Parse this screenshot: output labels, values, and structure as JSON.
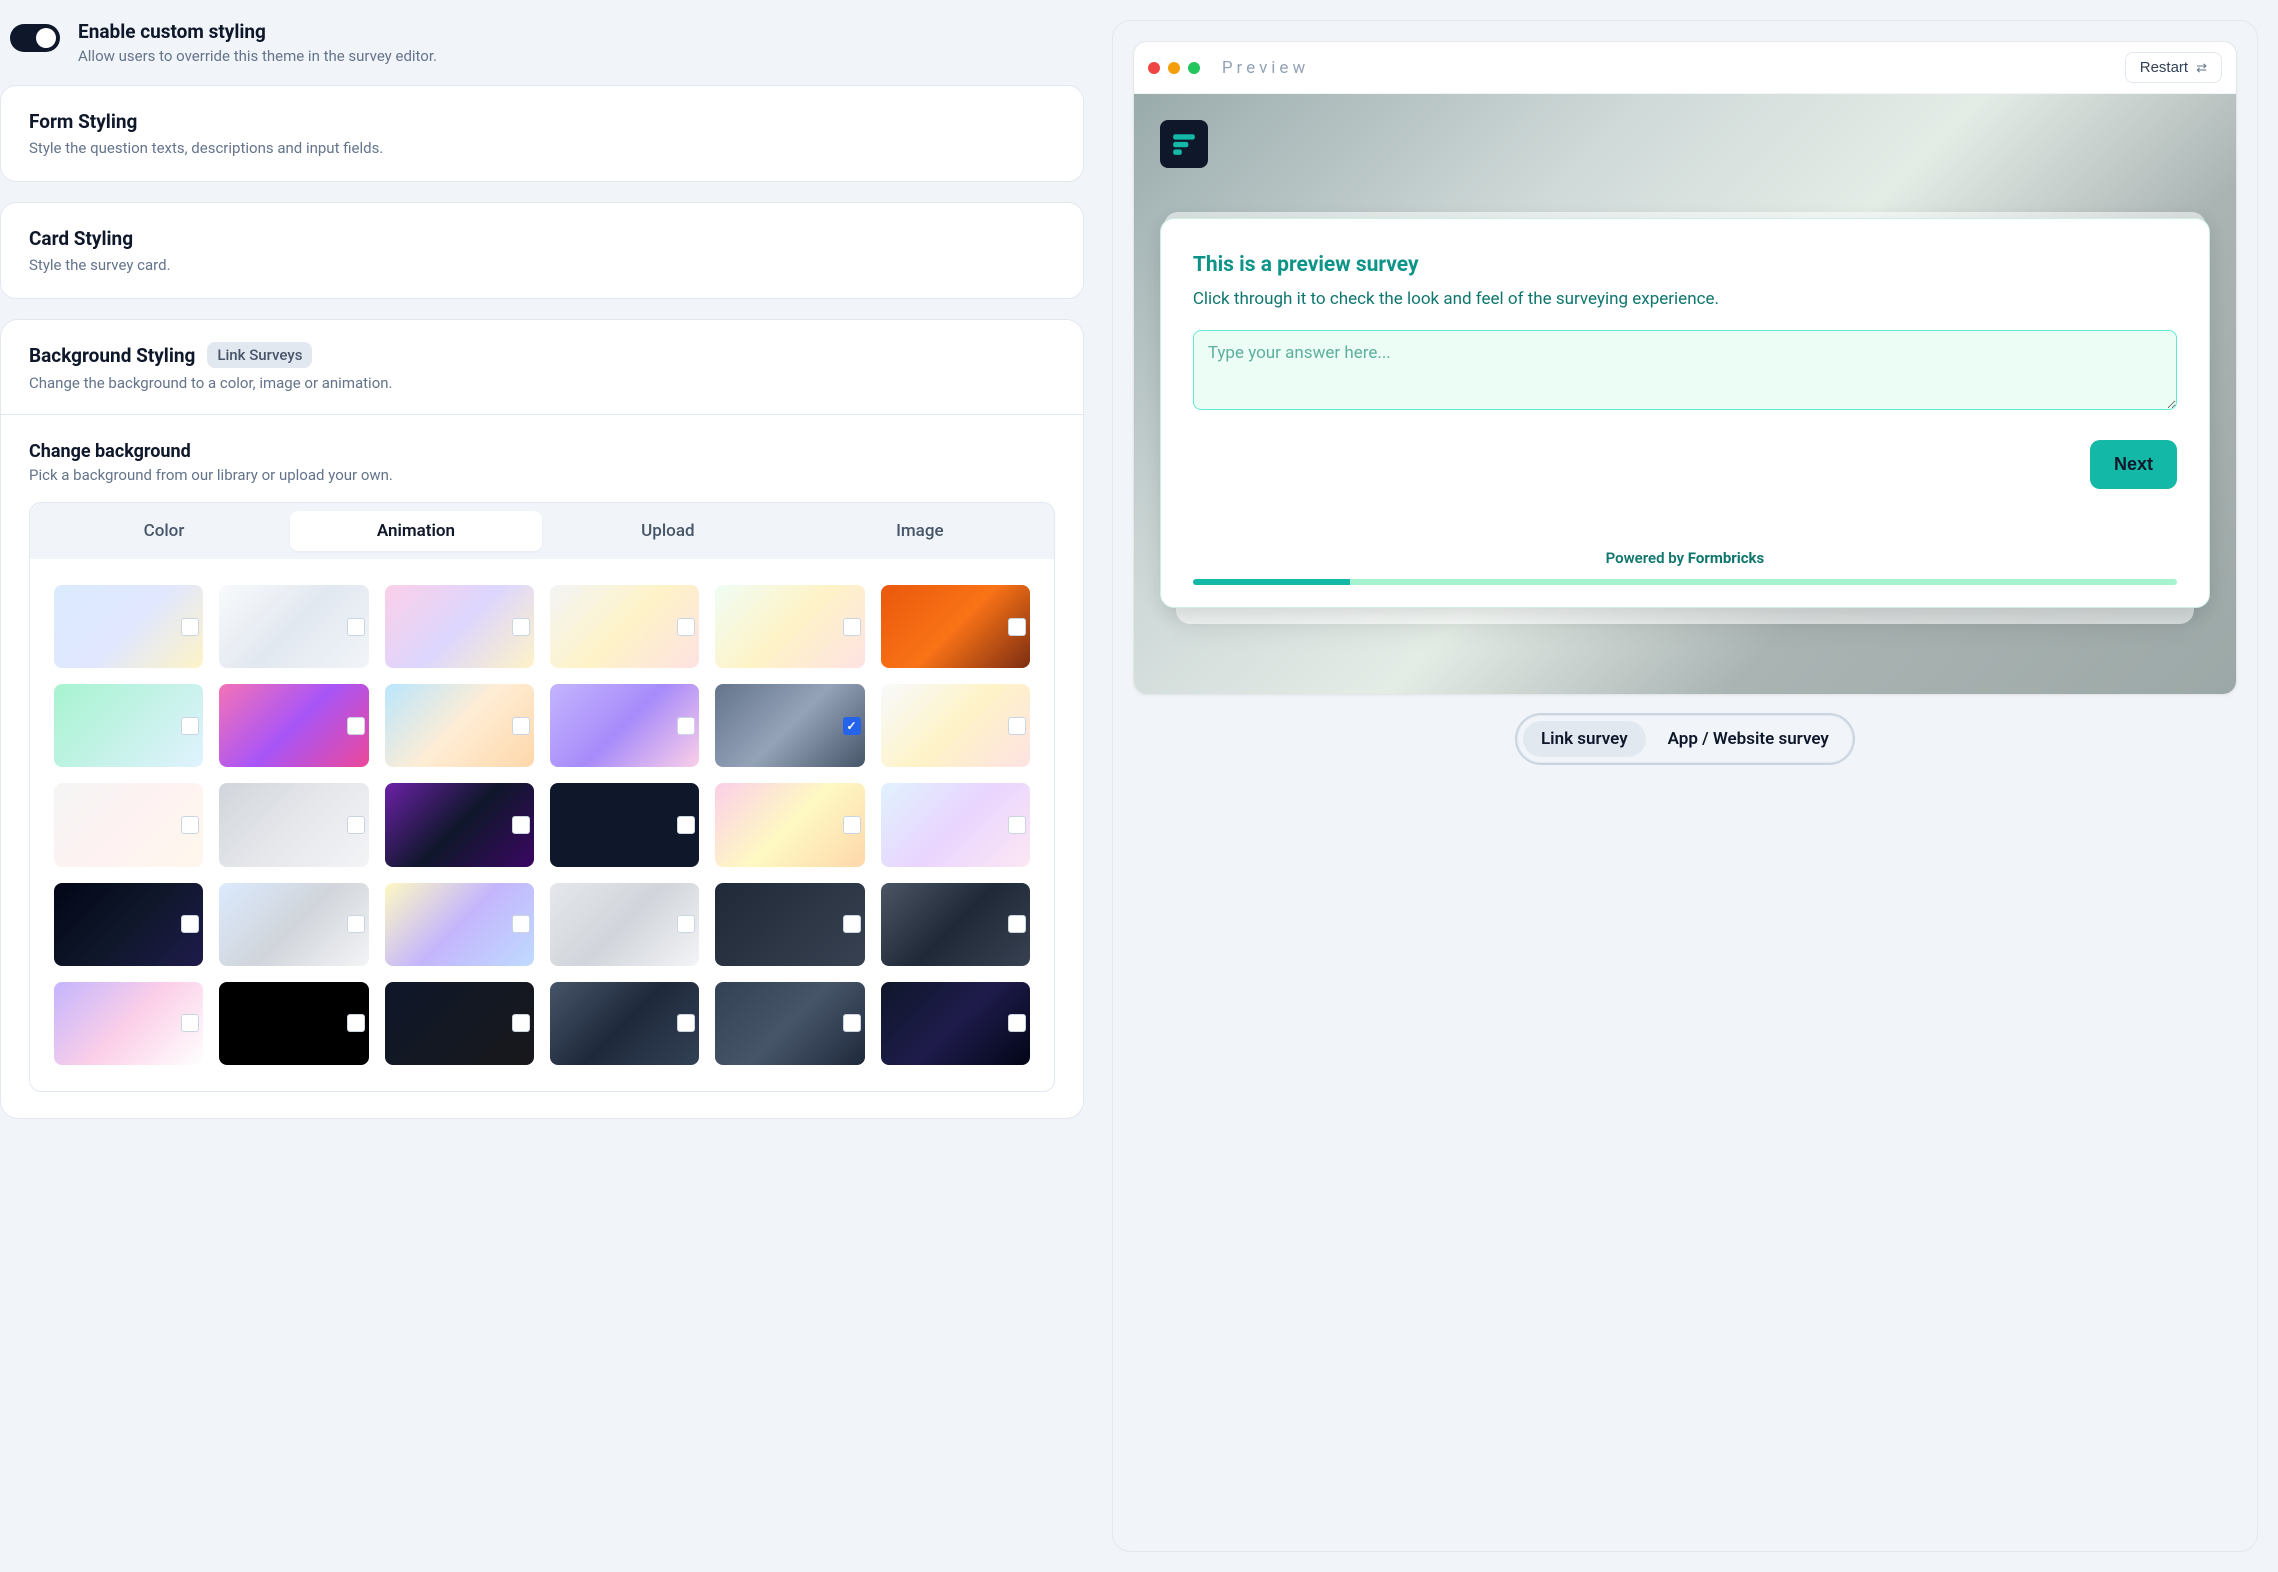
{
  "toggle": {
    "title": "Enable custom styling",
    "desc": "Allow users to override this theme in the survey editor."
  },
  "sections": {
    "form": {
      "title": "Form Styling",
      "desc": "Style the question texts, descriptions and input fields."
    },
    "card": {
      "title": "Card Styling",
      "desc": "Style the survey card."
    },
    "bg": {
      "title": "Background Styling",
      "chip": "Link Surveys",
      "desc": "Change the background to a color, image or animation."
    },
    "change_bg": {
      "title": "Change background",
      "desc": "Pick a background from our library or upload your own."
    }
  },
  "tabs": [
    "Color",
    "Animation",
    "Upload",
    "Image"
  ],
  "active_tab_index": 1,
  "thumb_count": 30,
  "selected_thumb_index": 10,
  "preview": {
    "label": "Preview",
    "restart": "Restart",
    "survey": {
      "title": "This is a preview survey",
      "desc": "Click through it to check the look and feel of the surveying experience.",
      "placeholder": "Type your answer here...",
      "next": "Next",
      "powered_prefix": "Powered by ",
      "powered_brand": "Formbricks"
    }
  },
  "survey_types": [
    "Link survey",
    "App / Website survey"
  ],
  "active_survey_type_index": 0
}
